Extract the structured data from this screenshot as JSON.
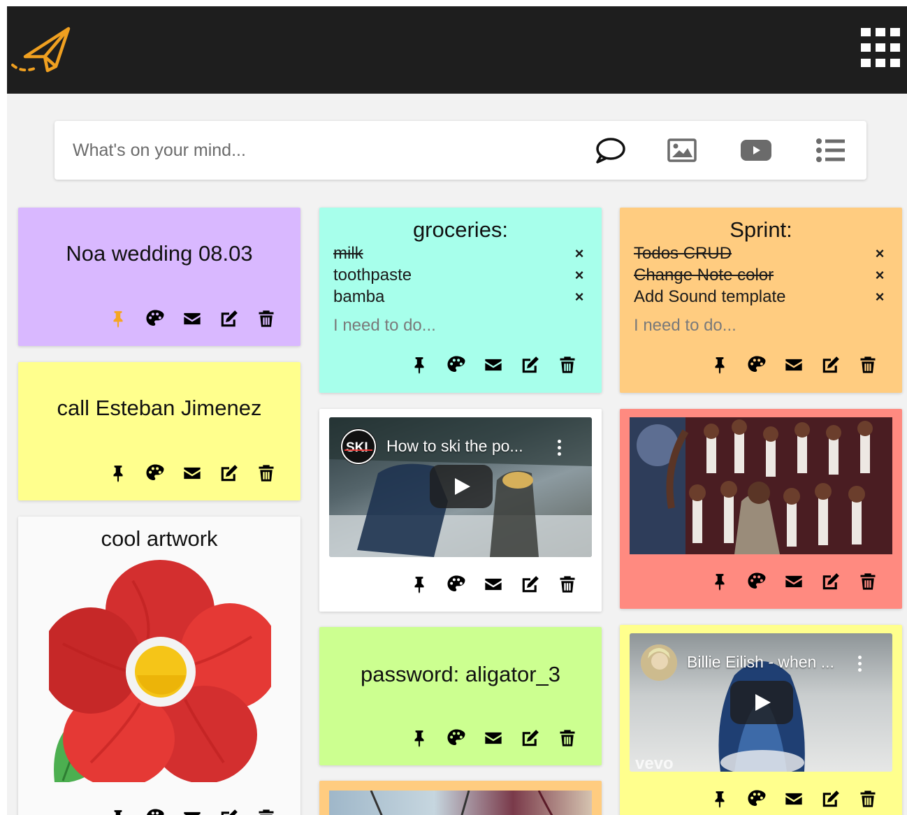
{
  "header": {
    "logo_icon": "paper-plane-icon",
    "apps_icon": "apps-grid-icon",
    "background": "#1e1e1e",
    "accent": "#f0a020"
  },
  "composer": {
    "placeholder": "What's on your mind...",
    "buttons": [
      {
        "icon": "speech-bubble-icon",
        "label": "text note"
      },
      {
        "icon": "image-icon",
        "label": "image note"
      },
      {
        "icon": "youtube-icon",
        "label": "video note"
      },
      {
        "icon": "list-icon",
        "label": "todo note"
      }
    ]
  },
  "notes": {
    "noa": {
      "title": "Noa wedding 08.03",
      "color": "#d9b8ff",
      "pinned": true
    },
    "esteban": {
      "title": "call Esteban Jimenez",
      "color": "#ffff8d",
      "pinned": false
    },
    "artwork": {
      "title": "cool artwork",
      "color": "#fafafa",
      "image": "red-flower-image"
    },
    "groceries": {
      "title": "groceries:",
      "color": "#a7ffeb",
      "items": [
        {
          "text": "milk",
          "done": true
        },
        {
          "text": "toothpaste",
          "done": false
        },
        {
          "text": "bamba",
          "done": false
        }
      ],
      "input_placeholder": "I need to do..."
    },
    "ski_video": {
      "video_title": "How to ski the po...",
      "color": "#ffffff",
      "channel": "ski-channel-logo"
    },
    "password": {
      "title": "password: aligator_3",
      "color": "#ccff90"
    },
    "sprint": {
      "title": "Sprint:",
      "color": "#ffcc80",
      "items": [
        {
          "text": "Todos CRUD",
          "done": true
        },
        {
          "text": "Change Note color",
          "done": true
        },
        {
          "text": "Add Sound template",
          "done": false
        }
      ],
      "input_placeholder": "I need to do..."
    },
    "choir_image": {
      "color": "#ff8a80",
      "image": "choir-photo"
    },
    "billie_video": {
      "video_title": "Billie Eilish - when ...",
      "color": "#ffff8d",
      "watermark": "vevo"
    },
    "partial_bottom": {
      "color": "#ffcc80"
    }
  },
  "note_actions": {
    "pin": "pin-icon",
    "palette": "palette-icon",
    "email": "envelope-icon",
    "edit": "edit-icon",
    "delete": "trash-icon",
    "pinned_color": "#f5a623",
    "remove_item": "×"
  }
}
